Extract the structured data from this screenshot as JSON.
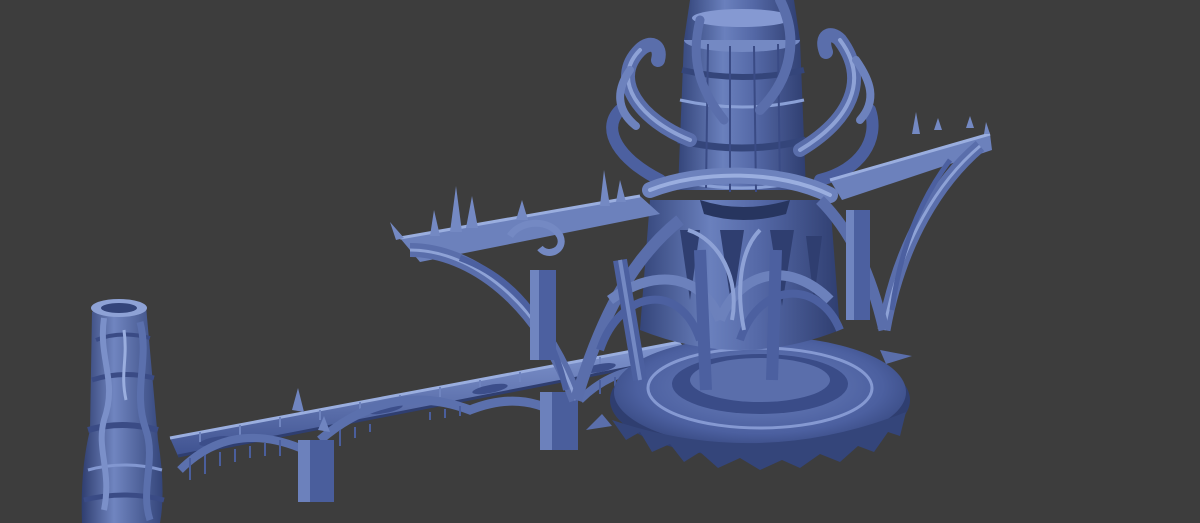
{
  "viewport": {
    "background_color": "#3d3d3d",
    "model_base_color": "#4f66a3",
    "model_shadow_color": "#34457a",
    "model_highlight_color": "#8fa3d6",
    "model_mid_color": "#6479b4",
    "render_mode": "clay-shaded-model"
  }
}
